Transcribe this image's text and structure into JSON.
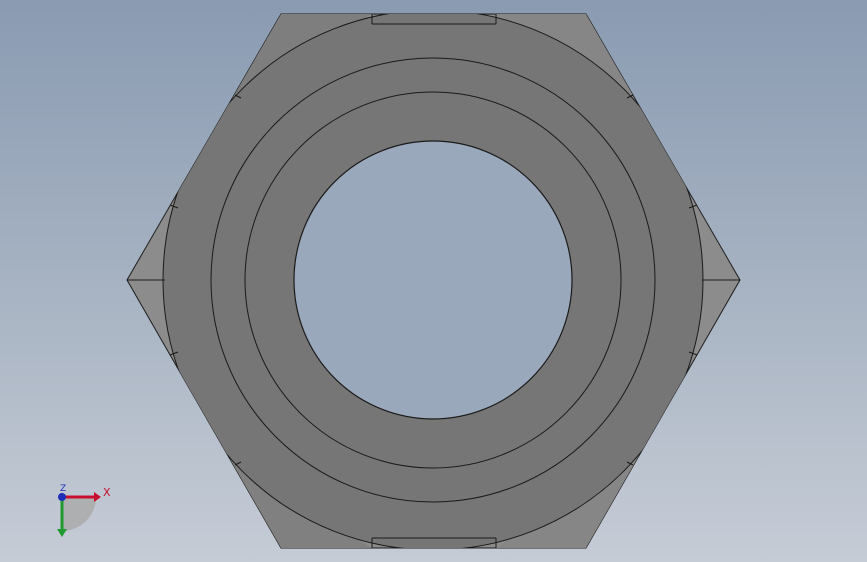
{
  "viewport": {
    "background_top": "#8a9bb2",
    "background_bottom": "#c6ccd6"
  },
  "model": {
    "part": "hex-nut",
    "view": "front",
    "face_color": "#767676",
    "chamfer_color": "#8a8a8a",
    "edge_color": "#1a1a1a"
  },
  "triad": {
    "x_label": "X",
    "y_label": "Y",
    "z_label": "Z",
    "x_color": "#c8102e",
    "y_color": "#1f9a2e",
    "z_color": "#1d2fb8"
  }
}
